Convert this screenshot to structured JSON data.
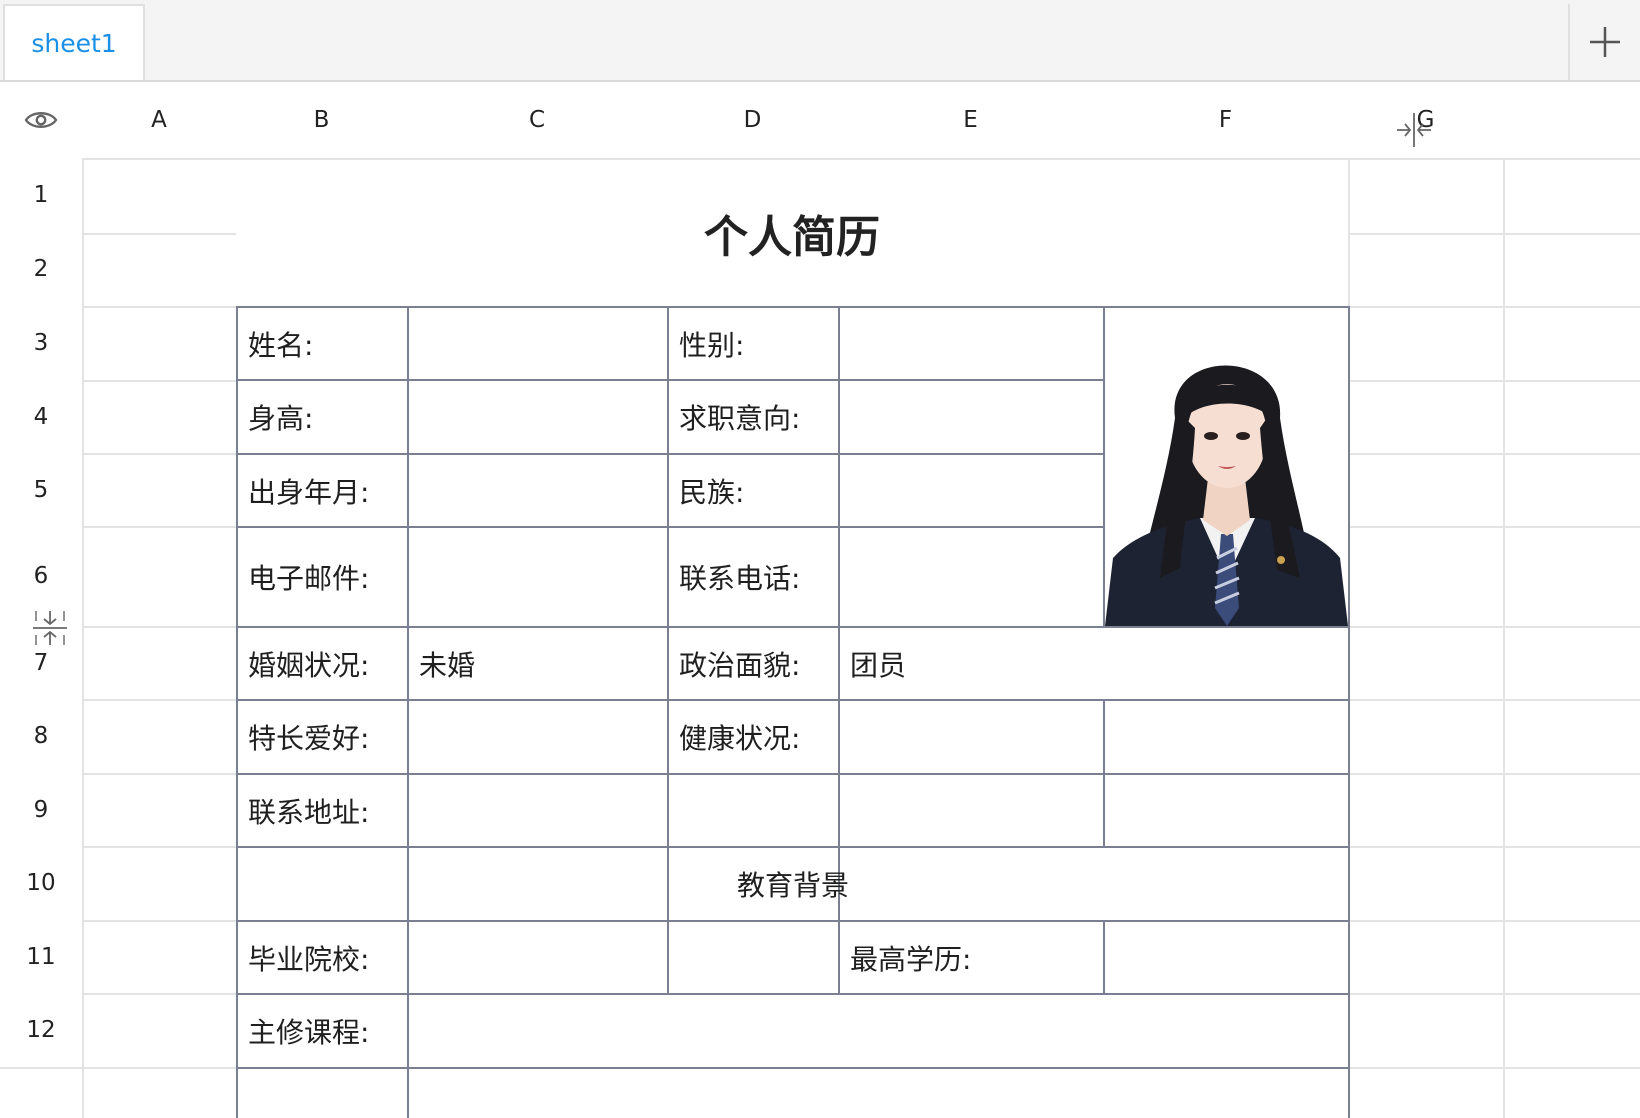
{
  "tabs": [
    {
      "label": "sheet1",
      "active": true
    }
  ],
  "add_sheet_icon": "plus-icon",
  "column_headers": [
    "A",
    "B",
    "C",
    "D",
    "E",
    "F",
    "G"
  ],
  "row_headers": [
    "1",
    "2",
    "3",
    "4",
    "5",
    "6",
    "7",
    "8",
    "9",
    "10",
    "11",
    "12"
  ],
  "toolbar_icons": {
    "visibility": "eye-icon",
    "column_collapse": "collapse-columns-icon",
    "row_collapse": "collapse-rows-icon"
  },
  "resume": {
    "title": "个人简历",
    "labels": {
      "name": "姓名:",
      "gender": "性别:",
      "height": "身高:",
      "job_intention": "求职意向:",
      "birth": "出身年月:",
      "ethnicity": "民族:",
      "email": "电子邮件:",
      "phone": "联系电话:",
      "marital": "婚姻状况:",
      "political": "政治面貌:",
      "hobbies": "特长爱好:",
      "health": "健康状况:",
      "address": "联系地址:",
      "school": "毕业院校:",
      "degree": "最高学历:",
      "courses": "主修课程:"
    },
    "values": {
      "marital": "未婚",
      "political": "团员"
    },
    "section_education": "教育背景",
    "photo_icon": "portrait-photo"
  },
  "colors": {
    "accent": "#1a8fe6",
    "border": "#7a8092",
    "grid": "#e3e3e3"
  }
}
